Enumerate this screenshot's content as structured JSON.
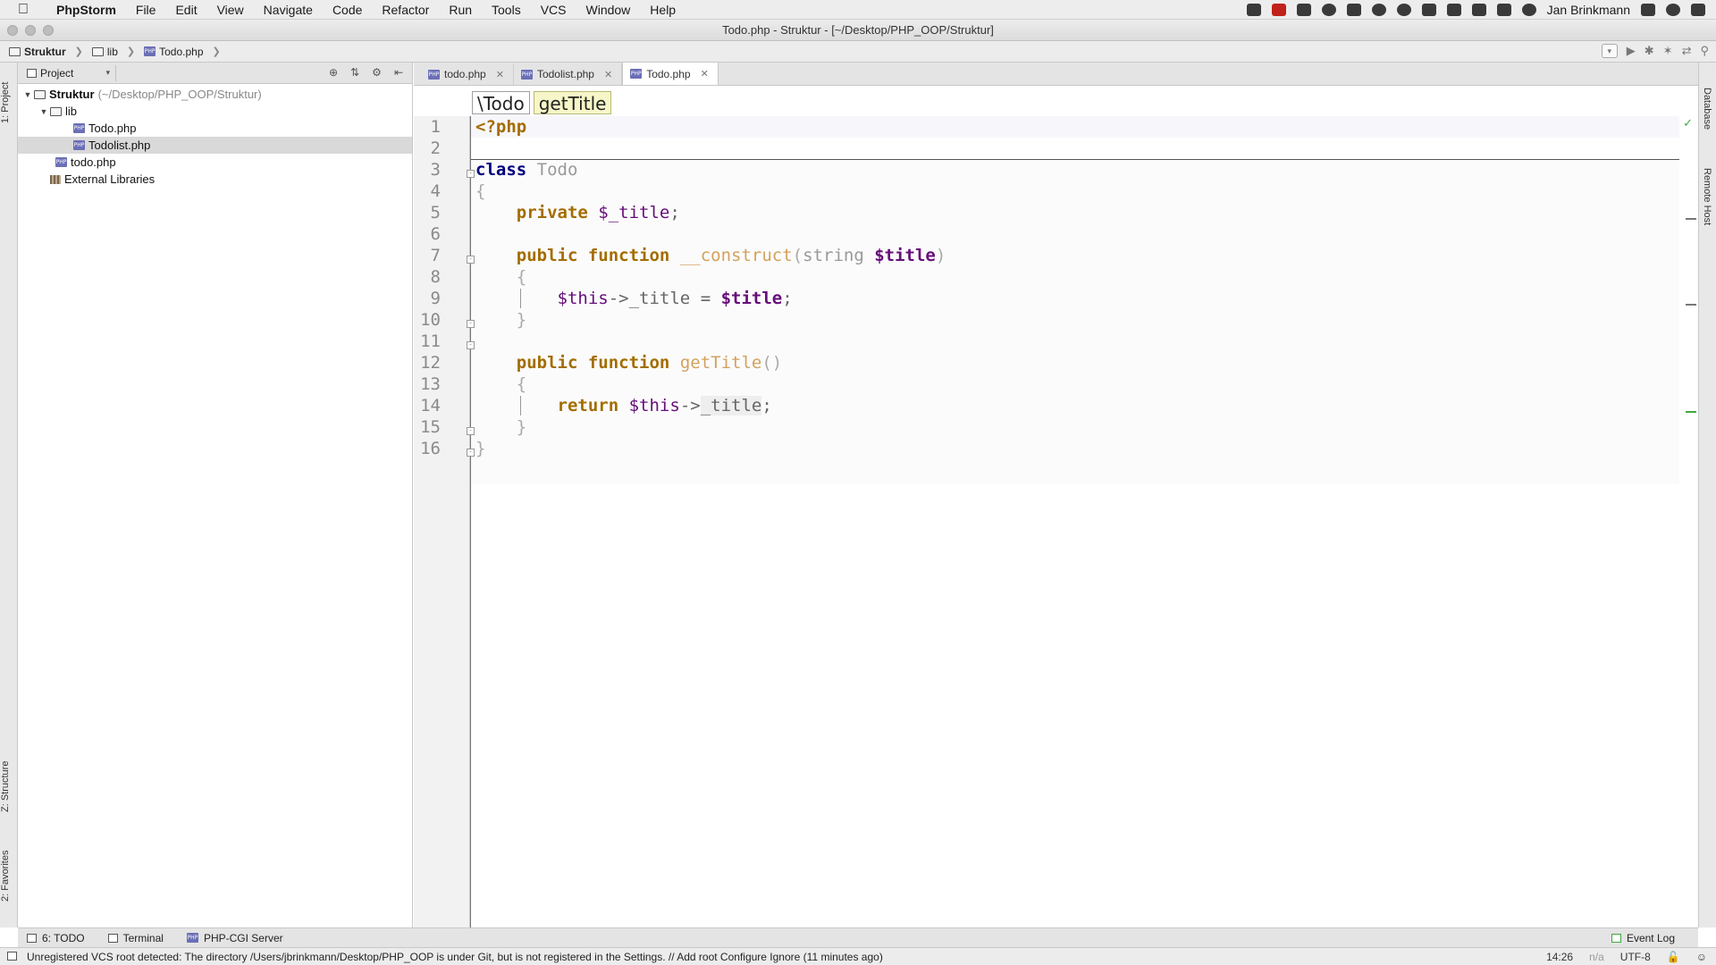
{
  "menubar": {
    "app": "PhpStorm",
    "items": [
      "File",
      "Edit",
      "View",
      "Navigate",
      "Code",
      "Refactor",
      "Run",
      "Tools",
      "VCS",
      "Window",
      "Help"
    ],
    "user": "Jan Brinkmann"
  },
  "window": {
    "title": "Todo.php - Struktur - [~/Desktop/PHP_OOP/Struktur]"
  },
  "navbar": {
    "crumbs": [
      "Struktur",
      "lib",
      "Todo.php"
    ]
  },
  "leftstrip": {
    "project": "1: Project",
    "structure": "Z: Structure",
    "favorites": "2: Favorites"
  },
  "rightstrip": {
    "database": "Database",
    "remote": "Remote Host"
  },
  "project": {
    "selector": "Project",
    "tree": [
      {
        "label": "Struktur",
        "path": "(~/Desktop/PHP_OOP/Struktur)"
      },
      {
        "label": "lib"
      },
      {
        "label": "Todo.php"
      },
      {
        "label": "Todolist.php"
      },
      {
        "label": "todo.php"
      },
      {
        "label": "External Libraries"
      }
    ]
  },
  "tabs": [
    {
      "label": "todo.php"
    },
    {
      "label": "Todolist.php"
    },
    {
      "label": "Todo.php"
    }
  ],
  "code_crumbs": [
    "\\Todo",
    "getTitle"
  ],
  "editor": {
    "line_numbers": [
      "1",
      "2",
      "3",
      "4",
      "5",
      "6",
      "7",
      "8",
      "9",
      "10",
      "11",
      "12",
      "13",
      "14",
      "15",
      "16"
    ]
  },
  "bottom_tools": {
    "todo": "6: TODO",
    "terminal": "Terminal",
    "server": "PHP-CGI Server",
    "event_log": "Event Log"
  },
  "status": {
    "message": "Unregistered VCS root detected: The directory /Users/jbrinkmann/Desktop/PHP_OOP is under Git, but is not registered in the Settings. // Add root  Configure  Ignore (11 minutes ago)",
    "position": "14:26",
    "na": "n/a",
    "encoding": "UTF-8"
  }
}
